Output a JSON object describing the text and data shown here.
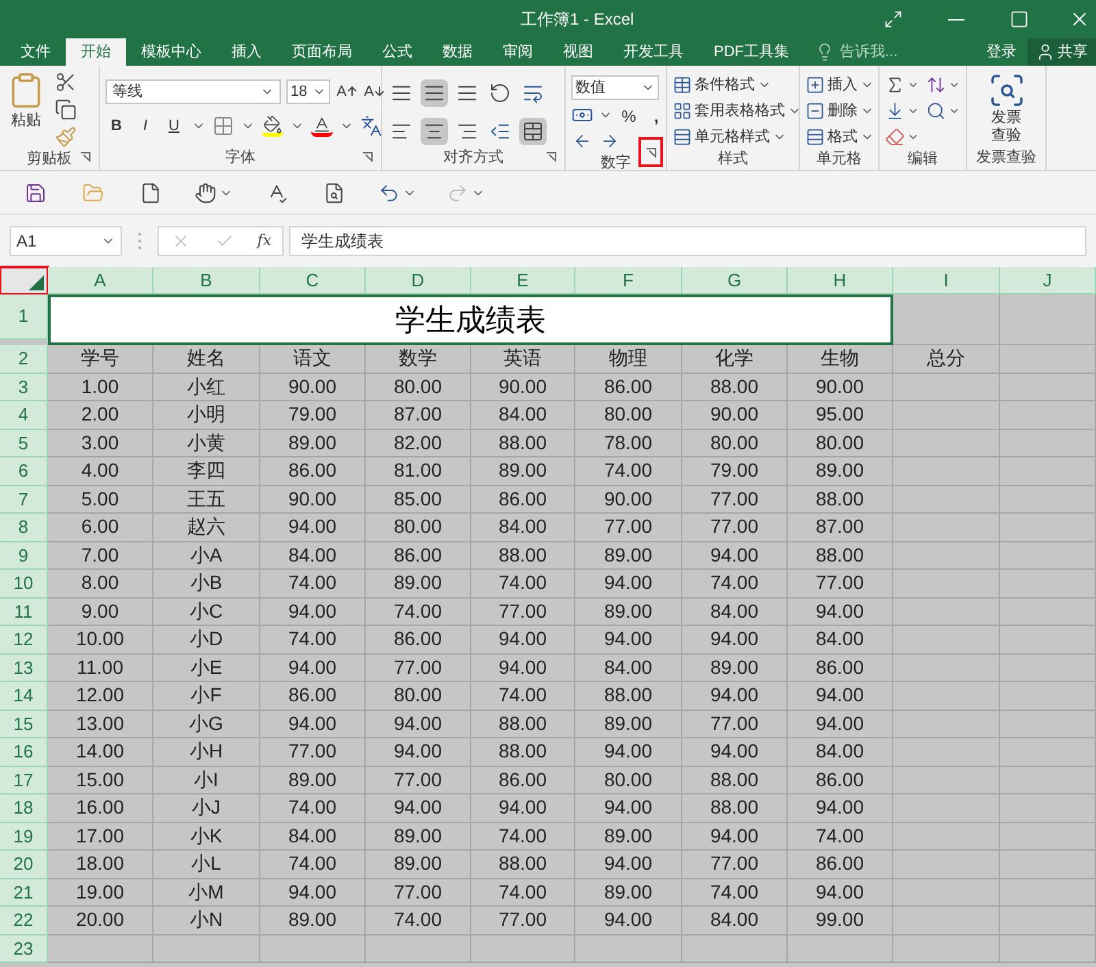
{
  "window": {
    "title": "工作簿1 - Excel"
  },
  "tabs": [
    {
      "label": "文件",
      "selected": false
    },
    {
      "label": "开始",
      "selected": true
    },
    {
      "label": "模板中心",
      "selected": false
    },
    {
      "label": "插入",
      "selected": false
    },
    {
      "label": "页面布局",
      "selected": false
    },
    {
      "label": "公式",
      "selected": false
    },
    {
      "label": "数据",
      "selected": false
    },
    {
      "label": "审阅",
      "selected": false
    },
    {
      "label": "视图",
      "selected": false
    },
    {
      "label": "开发工具",
      "selected": false
    },
    {
      "label": "PDF工具集",
      "selected": false
    }
  ],
  "tell_me": {
    "placeholder": "告诉我..."
  },
  "account": {
    "login": "登录",
    "share": "共享"
  },
  "ribbon": {
    "clipboard": {
      "label": "剪贴板",
      "paste": "粘贴"
    },
    "font": {
      "label": "字体",
      "font_name": "等线",
      "font_size": "18",
      "bold": "B",
      "italic": "I",
      "underline": "U"
    },
    "alignment": {
      "label": "对齐方式"
    },
    "number": {
      "label": "数字",
      "format": "数值",
      "percent": "%",
      "comma": ",",
      "launcher_highlighted": true
    },
    "styles": {
      "label": "样式",
      "buttons": [
        "条件格式",
        "套用表格格式",
        "单元格样式"
      ]
    },
    "cells": {
      "label": "单元格",
      "buttons": [
        "插入",
        "删除",
        "格式"
      ]
    },
    "editing": {
      "label": "编辑"
    },
    "invoice": {
      "label": "发票查验",
      "button": "发票查验"
    }
  },
  "formula_bar": {
    "name_box": "A1",
    "fx": "fx",
    "formula": "学生成绩表"
  },
  "sheet": {
    "select_all_highlighted": true,
    "all_selected": true,
    "columns": [
      "A",
      "B",
      "C",
      "D",
      "E",
      "F",
      "G",
      "H",
      "I",
      "J"
    ],
    "title": "学生成绩表",
    "header": [
      "学号",
      "姓名",
      "语文",
      "数学",
      "英语",
      "物理",
      "化学",
      "生物",
      "总分"
    ],
    "rows": [
      [
        "1.00",
        "小红",
        "90.00",
        "80.00",
        "90.00",
        "86.00",
        "88.00",
        "90.00"
      ],
      [
        "2.00",
        "小明",
        "79.00",
        "87.00",
        "84.00",
        "80.00",
        "90.00",
        "95.00"
      ],
      [
        "3.00",
        "小黄",
        "89.00",
        "82.00",
        "88.00",
        "78.00",
        "80.00",
        "80.00"
      ],
      [
        "4.00",
        "李四",
        "86.00",
        "81.00",
        "89.00",
        "74.00",
        "79.00",
        "89.00"
      ],
      [
        "5.00",
        "王五",
        "90.00",
        "85.00",
        "86.00",
        "90.00",
        "77.00",
        "88.00"
      ],
      [
        "6.00",
        "赵六",
        "94.00",
        "80.00",
        "84.00",
        "77.00",
        "77.00",
        "87.00"
      ],
      [
        "7.00",
        "小A",
        "84.00",
        "86.00",
        "88.00",
        "89.00",
        "94.00",
        "88.00"
      ],
      [
        "8.00",
        "小B",
        "74.00",
        "89.00",
        "74.00",
        "94.00",
        "74.00",
        "77.00"
      ],
      [
        "9.00",
        "小C",
        "94.00",
        "74.00",
        "77.00",
        "89.00",
        "84.00",
        "94.00"
      ],
      [
        "10.00",
        "小D",
        "74.00",
        "86.00",
        "94.00",
        "94.00",
        "94.00",
        "84.00"
      ],
      [
        "11.00",
        "小E",
        "94.00",
        "77.00",
        "94.00",
        "84.00",
        "89.00",
        "86.00"
      ],
      [
        "12.00",
        "小F",
        "86.00",
        "80.00",
        "74.00",
        "88.00",
        "94.00",
        "94.00"
      ],
      [
        "13.00",
        "小G",
        "94.00",
        "94.00",
        "88.00",
        "89.00",
        "77.00",
        "94.00"
      ],
      [
        "14.00",
        "小H",
        "77.00",
        "94.00",
        "88.00",
        "94.00",
        "94.00",
        "84.00"
      ],
      [
        "15.00",
        "小I",
        "89.00",
        "77.00",
        "86.00",
        "80.00",
        "88.00",
        "86.00"
      ],
      [
        "16.00",
        "小J",
        "74.00",
        "94.00",
        "94.00",
        "94.00",
        "88.00",
        "94.00"
      ],
      [
        "17.00",
        "小K",
        "84.00",
        "89.00",
        "74.00",
        "89.00",
        "94.00",
        "74.00"
      ],
      [
        "18.00",
        "小L",
        "74.00",
        "89.00",
        "88.00",
        "94.00",
        "77.00",
        "86.00"
      ],
      [
        "19.00",
        "小M",
        "94.00",
        "77.00",
        "74.00",
        "89.00",
        "74.00",
        "94.00"
      ],
      [
        "20.00",
        "小N",
        "89.00",
        "74.00",
        "77.00",
        "94.00",
        "84.00",
        "99.00"
      ]
    ],
    "row_numbers": [
      "1",
      "2",
      "3",
      "4",
      "5",
      "6",
      "7",
      "8",
      "9",
      "10",
      "11",
      "12",
      "13",
      "14",
      "15",
      "16",
      "17",
      "18",
      "19",
      "20",
      "21",
      "22",
      "23"
    ]
  }
}
